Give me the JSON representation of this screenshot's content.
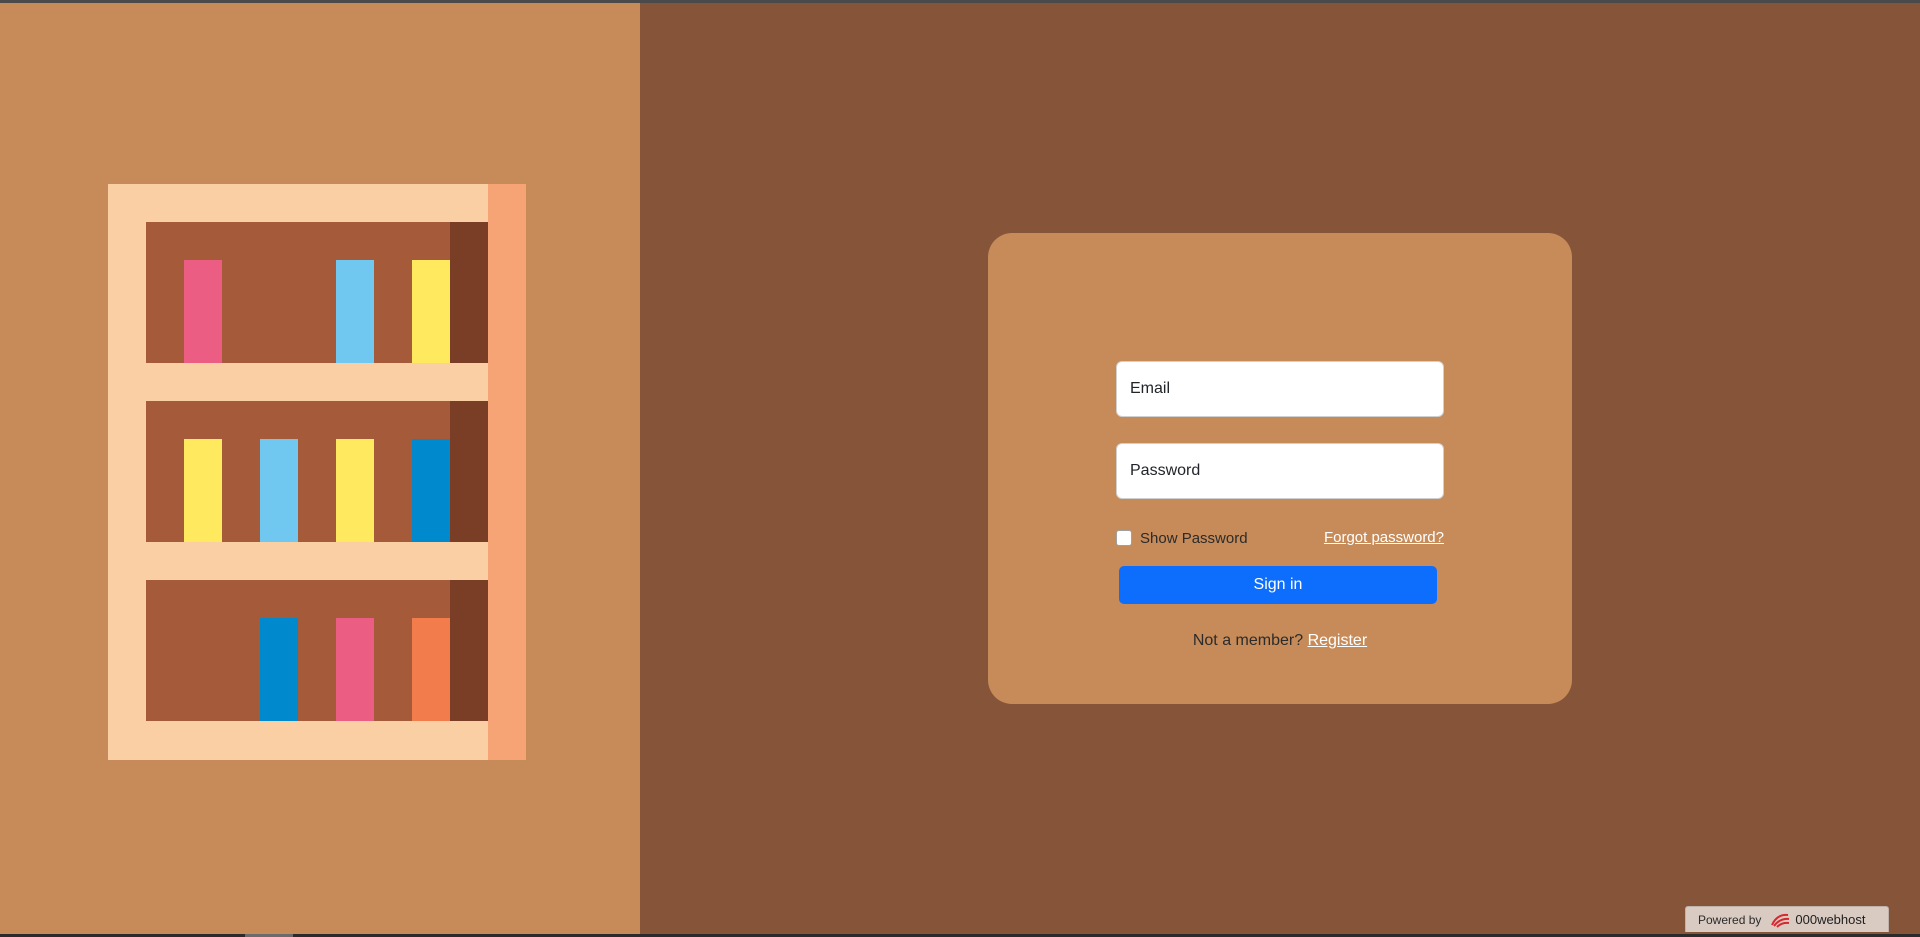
{
  "login": {
    "email_placeholder": "Email",
    "password_placeholder": "Password",
    "show_password_label": "Show Password",
    "forgot_password_label": "Forgot password?",
    "signin_label": "Sign in",
    "not_member_text": "Not a member?",
    "register_label": "Register"
  },
  "badge": {
    "powered_by": "Powered by",
    "brand": "000webhost"
  },
  "colors": {
    "left_panel": "#c68b59",
    "right_panel": "#865439",
    "card": "#c68b59",
    "primary_button": "#0d6efd",
    "shelf_frame": "#fbcfa4",
    "shelf_side": "#f6a475",
    "shelf_inner": "#a55a3a",
    "shelf_back": "#7a3e27",
    "book_pink": "#eb5d82",
    "book_lightblue": "#70c7ef",
    "book_yellow": "#ffe95e",
    "book_blue": "#0089cd",
    "book_orange": "#f37c4d"
  },
  "icons": {
    "bookshelf": "bookshelf-illustration",
    "brand_logo": "000webhost-logo-icon"
  }
}
